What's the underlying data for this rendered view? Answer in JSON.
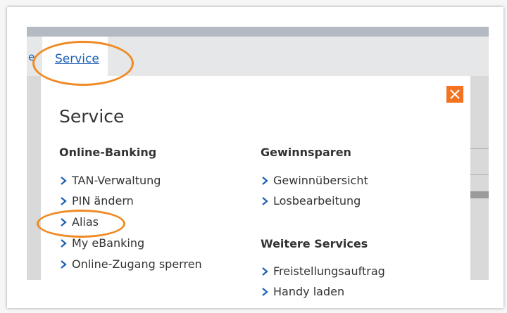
{
  "nav": {
    "cut_label": "e",
    "active_tab": "Service"
  },
  "panel": {
    "title": "Service",
    "close_icon": "close-x-icon",
    "accent_color": "#f37321",
    "link_color": "#1a5fb4",
    "columns": [
      {
        "heading": "Online-Banking",
        "items": [
          "TAN-Verwaltung",
          "PIN ändern",
          "Alias",
          "My eBanking",
          "Online-Zugang sperren"
        ]
      },
      {
        "heading": "Gewinnsparen",
        "items": [
          "Gewinnübersicht",
          "Losbearbeitung"
        ]
      },
      {
        "heading": "Weitere Services",
        "items": [
          "Freistellungsauftrag",
          "Handy laden"
        ]
      }
    ]
  },
  "highlight_color": "#f08a24"
}
